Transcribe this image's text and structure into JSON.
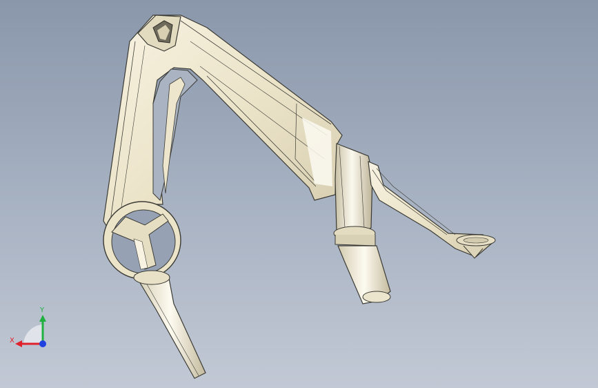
{
  "viewport": {
    "background_top": "#8a97ab",
    "background_bottom": "#c2c9d5"
  },
  "model": {
    "part_color": "#efe8d2",
    "edge_color": "#3a3a34",
    "shade_color": "#c9c1a6"
  },
  "triad": {
    "x_label": "X",
    "y_label": "Y",
    "x_color": "#e0202a",
    "y_color": "#20b040",
    "z_color": "#2040e0"
  }
}
